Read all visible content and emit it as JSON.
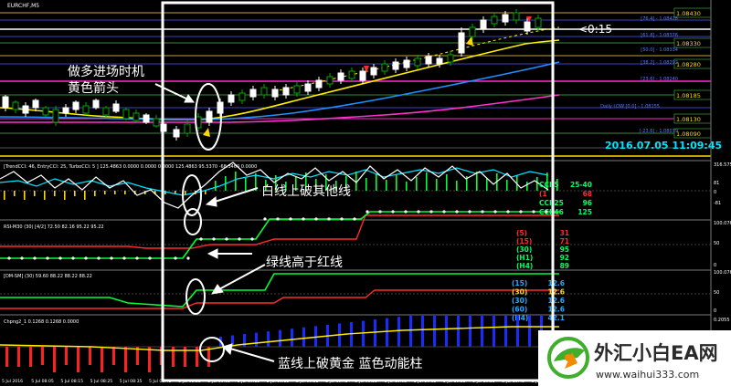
{
  "window": {
    "symbol_title": "EURCHF,M5"
  },
  "annotations": {
    "entry_note_line1": "做多进场时机",
    "entry_note_line2": "黄色箭头",
    "cci_note": "白线上破其他线",
    "rsi_note": "绿线高于红线",
    "gold_note": "蓝线上破黄金  蓝色动能柱"
  },
  "main_chart": {
    "countdown": "<0:15",
    "timestamp": "2016.07.05 11:09:45",
    "price_boxes": [
      "1.08430",
      "1.08330",
      "1.08280",
      "1.08185",
      "1.08130",
      "1.08090"
    ],
    "level_tags": [
      "[76.4] - 1.08428",
      "[61.8] - 1.08376",
      "[50.0] - 1.08334",
      "[38.2] - 1.08292",
      "[23.6] - 1.08240",
      "Daily LOW [0.0] - 1.08155",
      "[-23.6] - 1.08079"
    ]
  },
  "cci_panel": {
    "header": "[TrendCCI: 46, EntryCCI: 25, TurboCCI: 5 ]  125.4863 0.0000 0.0000 0.0000 125.4863 95.5370 -68.3460 0.0000",
    "scale": [
      "316.5751",
      "81",
      "0",
      "-81"
    ],
    "legend": [
      {
        "label": "CCI 5",
        "value": "25-40",
        "color": "#00ff66"
      },
      {
        "label": "(1",
        "value": "68",
        "color": "#ff2b2b"
      },
      {
        "label": "CCI 25",
        "value": "96",
        "color": "#00ff66"
      },
      {
        "label": "CCI 46",
        "value": "125",
        "color": "#00ff66"
      }
    ]
  },
  "rsi_panel": {
    "header": "RSI-M30 (30) [4/2]  72.50 82.16 95.22 95.22",
    "scale": [
      "100.0762",
      "50",
      "0"
    ],
    "legend": [
      {
        "label": "(5)",
        "value": "31",
        "color": "#ff2b2b"
      },
      {
        "label": "(15)",
        "value": "71",
        "color": "#ff2b2b"
      },
      {
        "label": "(30)",
        "value": "95",
        "color": "#00ff66"
      },
      {
        "label": "(H1)",
        "value": "92",
        "color": "#00ff66"
      },
      {
        "label": "(H4)",
        "value": "89",
        "color": "#00ff66"
      }
    ]
  },
  "dm_panel": {
    "header": "[DM-SM] (30) 59.60 88.22 88.22 88.22",
    "scale": [
      "100.0762",
      "50",
      "0"
    ],
    "legend": [
      {
        "label": "(15)",
        "value": "12.6",
        "color": "#22aaff"
      },
      {
        "label": "(30)",
        "value": "12.6",
        "color": "#ffd800"
      },
      {
        "label": "(30)",
        "value": "12.6",
        "color": "#22aaff"
      },
      {
        "label": "(60)",
        "value": "12.6",
        "color": "#22aaff"
      },
      {
        "label": "(H4)",
        "value": "42.1",
        "color": "#22aaff"
      }
    ]
  },
  "gold_panel": {
    "header": "Chpng2_1 0.1268 0.1268 0.0000",
    "scale": [
      "0.2055",
      "0"
    ]
  },
  "time_axis": [
    "5 Jul 2016",
    "5 Jul 08:05",
    "5 Jul 08:15",
    "5 Jul 08:25",
    "5 Jul 08:35",
    "5 Jul 08:45",
    "5 Jul 08:55",
    "5 Jul 09:05",
    "5 Jul 09:15",
    "5 Jul 09:25",
    "5 Jul 09:35",
    "5 Jul 09:45",
    "5 Jul 09:55",
    "5 Jul 10:05",
    "5 Jul 10:15",
    "5 Jul 10:25",
    "5 Jul 10:35",
    "5 Jul 10:45",
    "5 Jul 10:55"
  ],
  "watermark": {
    "brand": "外汇小白EA网",
    "url": "www.waihui333.com"
  },
  "colors": {
    "bull": "#ffffff",
    "bear": "#00aa00",
    "ma_yellow": "#ffee00",
    "ma_blue": "#1e90ff",
    "ma_magenta": "#ff33cc",
    "highlight": "#ffffff"
  },
  "icons": [
    "entry-arrow-icon",
    "circle-highlight-icon",
    "callout-arrow-icon",
    "watermark-logo-icon"
  ]
}
